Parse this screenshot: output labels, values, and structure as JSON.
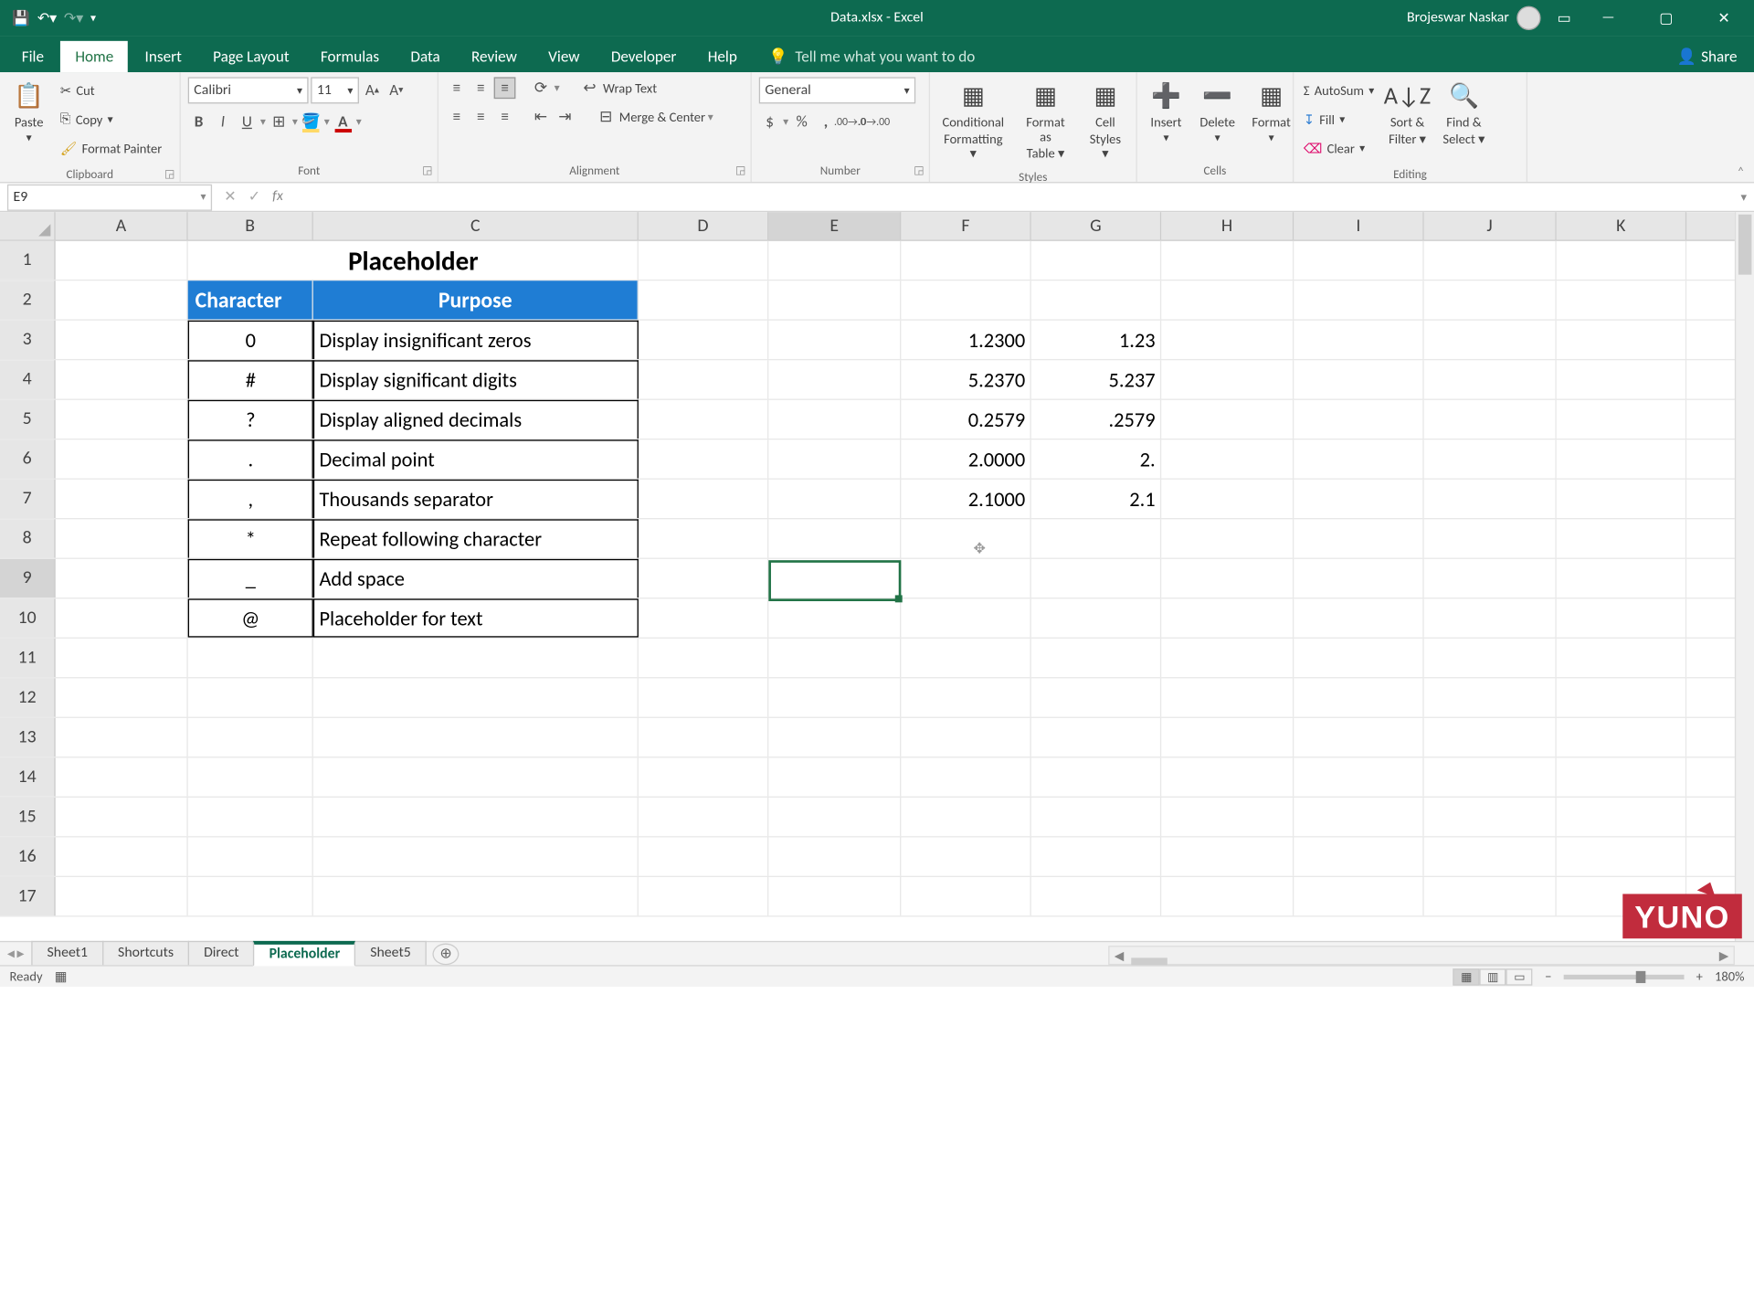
{
  "title_bar": {
    "doc": "Data.xlsx  -  Excel",
    "user": "Brojeswar Naskar"
  },
  "tabs": {
    "file": "File",
    "home": "Home",
    "insert": "Insert",
    "page_layout": "Page Layout",
    "formulas": "Formulas",
    "data": "Data",
    "review": "Review",
    "view": "View",
    "developer": "Developer",
    "help": "Help",
    "tell": "Tell me what you want to do",
    "share": "Share"
  },
  "ribbon": {
    "clipboard": {
      "paste": "Paste",
      "cut": "Cut",
      "copy": "Copy",
      "fp": "Format Painter",
      "label": "Clipboard"
    },
    "font": {
      "name": "Calibri",
      "size": "11",
      "label": "Font"
    },
    "alignment": {
      "wrap": "Wrap Text",
      "merge": "Merge & Center",
      "label": "Alignment"
    },
    "number": {
      "format": "General",
      "label": "Number"
    },
    "styles": {
      "cf1": "Conditional",
      "cf2": "Formatting",
      "ft1": "Format as",
      "ft2": "Table",
      "cs1": "Cell",
      "cs2": "Styles",
      "label": "Styles"
    },
    "cells": {
      "ins": "Insert",
      "del": "Delete",
      "fmt": "Format",
      "label": "Cells"
    },
    "editing": {
      "as": "AutoSum",
      "fill": "Fill",
      "clear": "Clear",
      "sf1": "Sort &",
      "sf2": "Filter",
      "fs1": "Find &",
      "fs2": "Select",
      "label": "Editing"
    }
  },
  "namebox": "E9",
  "columns": [
    "A",
    "B",
    "C",
    "D",
    "E",
    "F",
    "G",
    "H",
    "I",
    "J",
    "K"
  ],
  "sheet": {
    "title": "Placeholder",
    "hdr_char": "Character",
    "hdr_purpose": "Purpose",
    "rows": [
      {
        "ch": "0",
        "p": "Display insignificant zeros"
      },
      {
        "ch": "#",
        "p": "Display significant digits"
      },
      {
        "ch": "?",
        "p": "Display aligned decimals"
      },
      {
        "ch": ".",
        "p": "Decimal point"
      },
      {
        "ch": ",",
        "p": "Thousands separator"
      },
      {
        "ch": "*",
        "p": "Repeat following character"
      },
      {
        "ch": "_",
        "p": "Add space"
      },
      {
        "ch": "@",
        "p": "Placeholder for text"
      }
    ],
    "fvals": [
      "1.2300",
      "5.2370",
      "0.2579",
      "2.0000",
      "2.1000"
    ],
    "gvals": [
      "1.23",
      "5.237",
      ".2579",
      "2.",
      "2.1"
    ]
  },
  "sheet_tabs": [
    "Sheet1",
    "Shortcuts",
    "Direct",
    "Placeholder",
    "Sheet5"
  ],
  "status": {
    "ready": "Ready",
    "zoom": "180%"
  },
  "brand": "YUNO"
}
